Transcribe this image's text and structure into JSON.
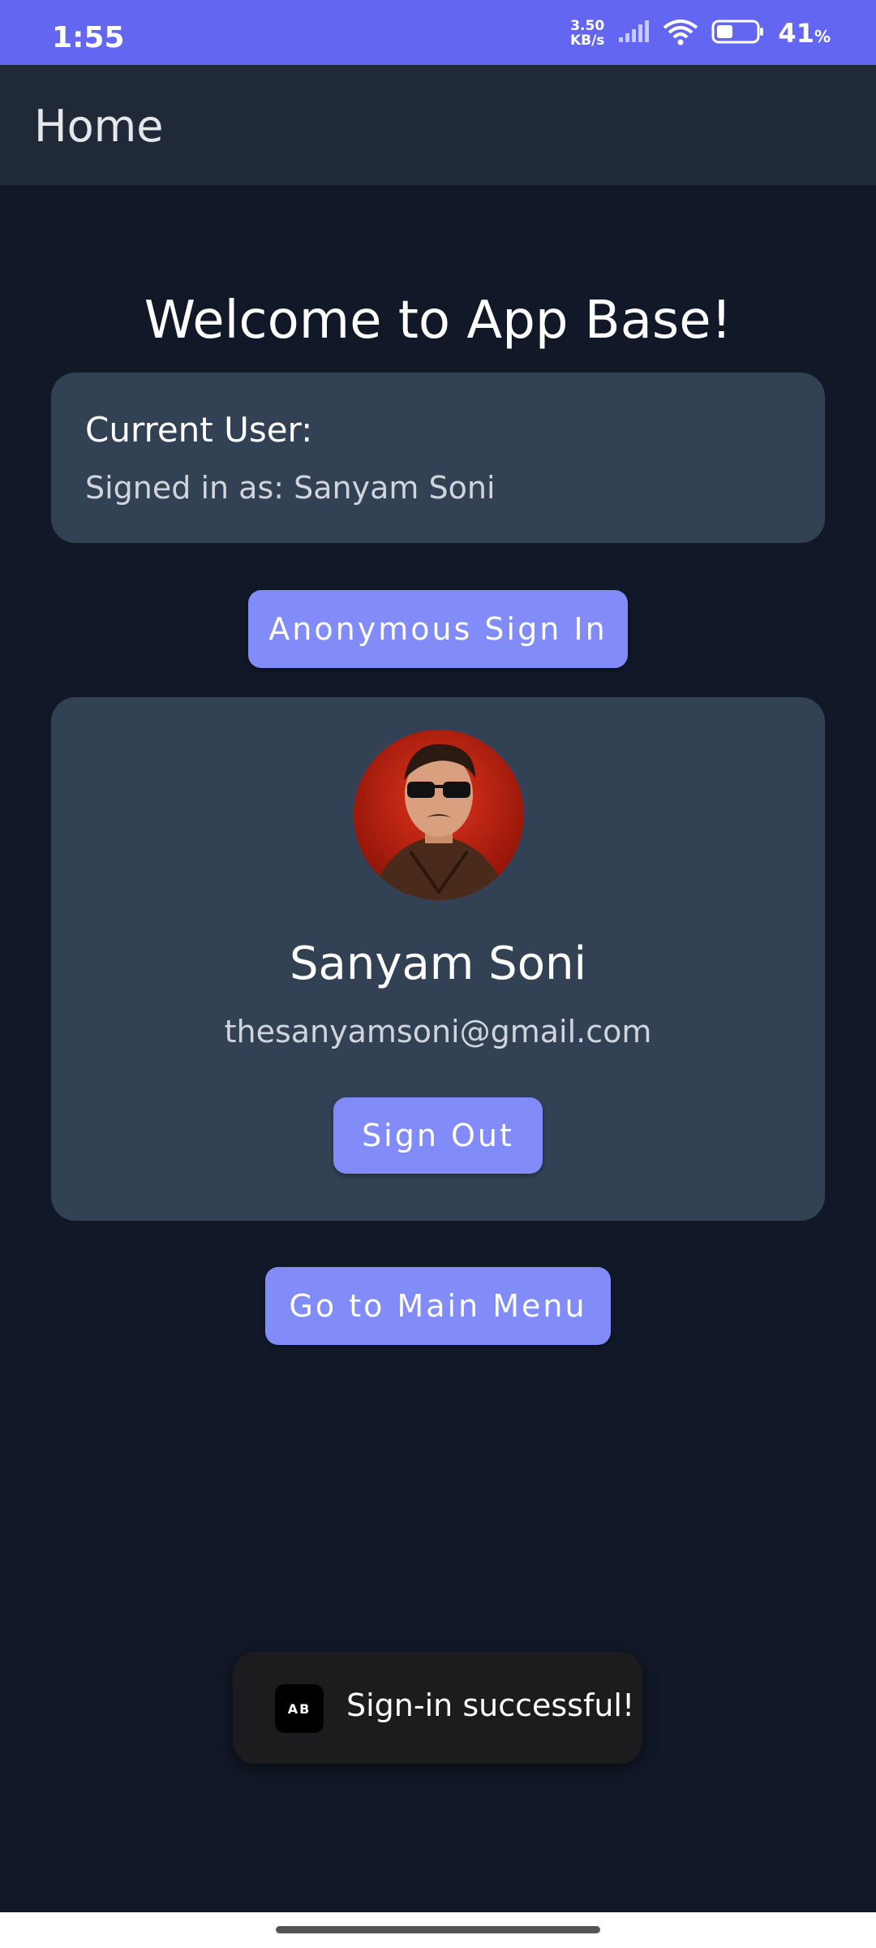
{
  "status_bar": {
    "time": "1:55",
    "net_speed_value": "3.50",
    "net_speed_unit": "KB/s",
    "battery": "41",
    "battery_unit": "%",
    "battery_level": 0.41,
    "background_color": "#6366f1"
  },
  "app_bar": {
    "title": "Home"
  },
  "main": {
    "welcome": "Welcome to App Base!",
    "current_user_label": "Current User:",
    "signed_in_text": "Signed in as: Sanyam Soni",
    "anonymous_button": "Anonymous Sign In",
    "profile": {
      "name": "Sanyam Soni",
      "email": "thesanyamsoni@gmail.com",
      "sign_out_button": "Sign Out"
    },
    "main_menu_button": "Go to Main Menu"
  },
  "toast": {
    "icon_text": "AB",
    "message": "Sign-in successful!"
  },
  "colors": {
    "background": "#111827",
    "card": "#334155",
    "button": "#818cf8",
    "app_bar": "#1f2937"
  }
}
